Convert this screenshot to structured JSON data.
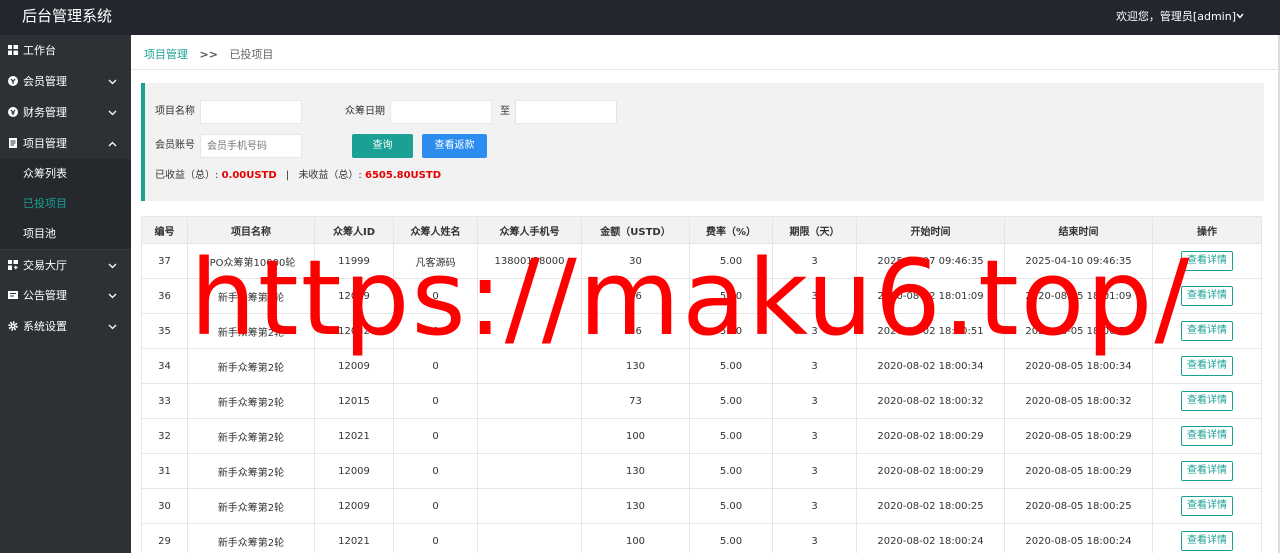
{
  "header": {
    "brand": "后台管理系统",
    "welcome": "欢迎您，管理员[admin]"
  },
  "sidebar": {
    "items": [
      {
        "label": "工作台",
        "icon": "dashboard-icon"
      },
      {
        "label": "会员管理",
        "icon": "member-icon"
      },
      {
        "label": "财务管理",
        "icon": "finance-icon"
      },
      {
        "label": "项目管理",
        "icon": "project-icon"
      },
      {
        "label": "交易大厅",
        "icon": "trade-icon"
      },
      {
        "label": "公告管理",
        "icon": "notice-icon"
      },
      {
        "label": "系统设置",
        "icon": "settings-icon"
      }
    ],
    "sub_items": [
      "众筹列表",
      "已投项目",
      "项目池"
    ],
    "active_sub": "已投项目"
  },
  "breadcrumb": {
    "parent": "项目管理",
    "separator": ">>",
    "current": "已投项目"
  },
  "search": {
    "project_name_label": "项目名称",
    "date_label": "众筹日期",
    "date_to": "至",
    "account_label": "会员账号",
    "account_placeholder": "会员手机号码",
    "query_button": "查询",
    "refund_button": "查看返款",
    "earned_label": "已收益（总）:",
    "earned_value": "0.00USTD",
    "divider": "|",
    "pending_label": "未收益（总）:",
    "pending_value": "6505.80USTD"
  },
  "table": {
    "columns": [
      "编号",
      "项目名称",
      "众筹人ID",
      "众筹人姓名",
      "众筹人手机号",
      "金额（USTD）",
      "费率（%）",
      "期限（天）",
      "开始时间",
      "结束时间",
      "操作"
    ],
    "rows": [
      [
        "37",
        "IPO众筹第10000轮",
        "11999",
        "凡客源码",
        "13800138000",
        "30",
        "5.00",
        "3",
        "2025-04-07 09:46:35",
        "2025-04-10 09:46:35",
        "查看详情"
      ],
      [
        "36",
        "新手众筹第2轮",
        "12009",
        "0",
        "",
        "26",
        "5.00",
        "3",
        "2020-08-02 18:01:09",
        "2020-08-05 18:01:09",
        "查看详情"
      ],
      [
        "35",
        "新手众筹第2轮",
        "12032",
        "0",
        "",
        "36",
        "5.00",
        "3",
        "2020-08-02 18:00:51",
        "2020-08-05 18:00:51",
        "查看详情"
      ],
      [
        "34",
        "新手众筹第2轮",
        "12009",
        "0",
        "",
        "130",
        "5.00",
        "3",
        "2020-08-02 18:00:34",
        "2020-08-05 18:00:34",
        "查看详情"
      ],
      [
        "33",
        "新手众筹第2轮",
        "12015",
        "0",
        "",
        "73",
        "5.00",
        "3",
        "2020-08-02 18:00:32",
        "2020-08-05 18:00:32",
        "查看详情"
      ],
      [
        "32",
        "新手众筹第2轮",
        "12021",
        "0",
        "",
        "100",
        "5.00",
        "3",
        "2020-08-02 18:00:29",
        "2020-08-05 18:00:29",
        "查看详情"
      ],
      [
        "31",
        "新手众筹第2轮",
        "12009",
        "0",
        "",
        "130",
        "5.00",
        "3",
        "2020-08-02 18:00:29",
        "2020-08-05 18:00:29",
        "查看详情"
      ],
      [
        "30",
        "新手众筹第2轮",
        "12009",
        "0",
        "",
        "130",
        "5.00",
        "3",
        "2020-08-02 18:00:25",
        "2020-08-05 18:00:25",
        "查看详情"
      ],
      [
        "29",
        "新手众筹第2轮",
        "12021",
        "0",
        "",
        "100",
        "5.00",
        "3",
        "2020-08-02 18:00:24",
        "2020-08-05 18:00:24",
        "查看详情"
      ]
    ]
  },
  "watermark": "https://maku6.top/",
  "colors": {
    "accent": "#1aa094",
    "refund_button": "#2d8cf0",
    "topbar": "#23262e",
    "sidebar": "#2d3035",
    "highlight_red": "#e60000",
    "watermark": "#ff0000"
  }
}
